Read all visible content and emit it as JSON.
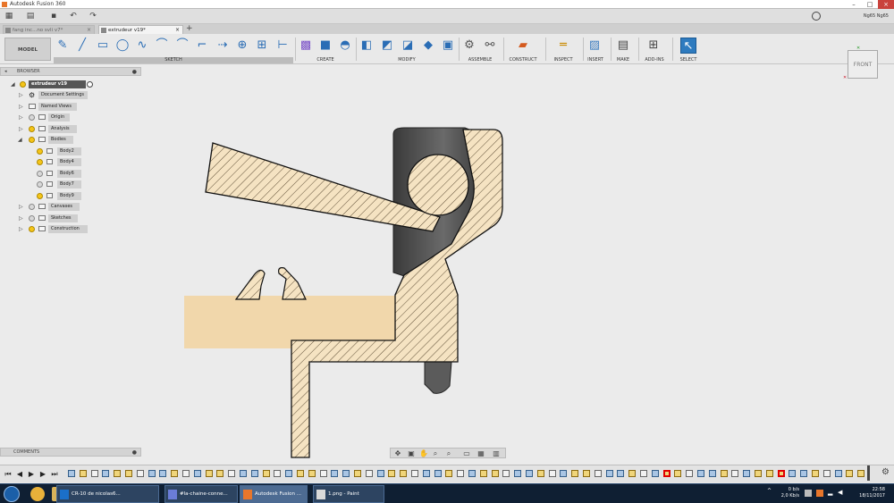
{
  "window": {
    "title": "Autodesk Fusion 360"
  },
  "quick_access": {
    "user_name": "Ng65 Ng65"
  },
  "tabs": [
    {
      "label": "fang inc...no svli v7*"
    },
    {
      "label": "extrudeur v19*"
    }
  ],
  "toolbar": {
    "mode": "MODEL",
    "groups": [
      "SKETCH",
      "CREATE",
      "MODIFY",
      "ASSEMBLE",
      "CONSTRUCT",
      "INSPECT",
      "INSERT",
      "MAKE",
      "ADD-INS",
      "SELECT"
    ]
  },
  "browser": {
    "header": "BROWSER",
    "root": "extrudeur v19",
    "items": [
      "Document Settings",
      "Named Views",
      "Origin",
      "Analysis",
      "Bodies",
      "Body2",
      "Body4",
      "Body6",
      "Body7",
      "Body9",
      "Canvases",
      "Sketches",
      "Construction"
    ]
  },
  "comments": {
    "header": "COMMENTS"
  },
  "viewcube": {
    "label": "FRONT"
  },
  "taskbar": {
    "items": [
      "CR-10 de nicolas6...",
      "#la-chaine-conne...",
      "Autodesk Fusion ...",
      "1.png - Paint"
    ],
    "net_up": "0 b/s",
    "net_down": "2,0 Kb/s",
    "time": "22:58",
    "date": "18/11/2017"
  },
  "colors": {
    "accent": "#1b5fa8",
    "hatch_fill": "#f5e3c2",
    "selected_body": "#f2d4a0",
    "timeline_highlight": "#e00000"
  }
}
